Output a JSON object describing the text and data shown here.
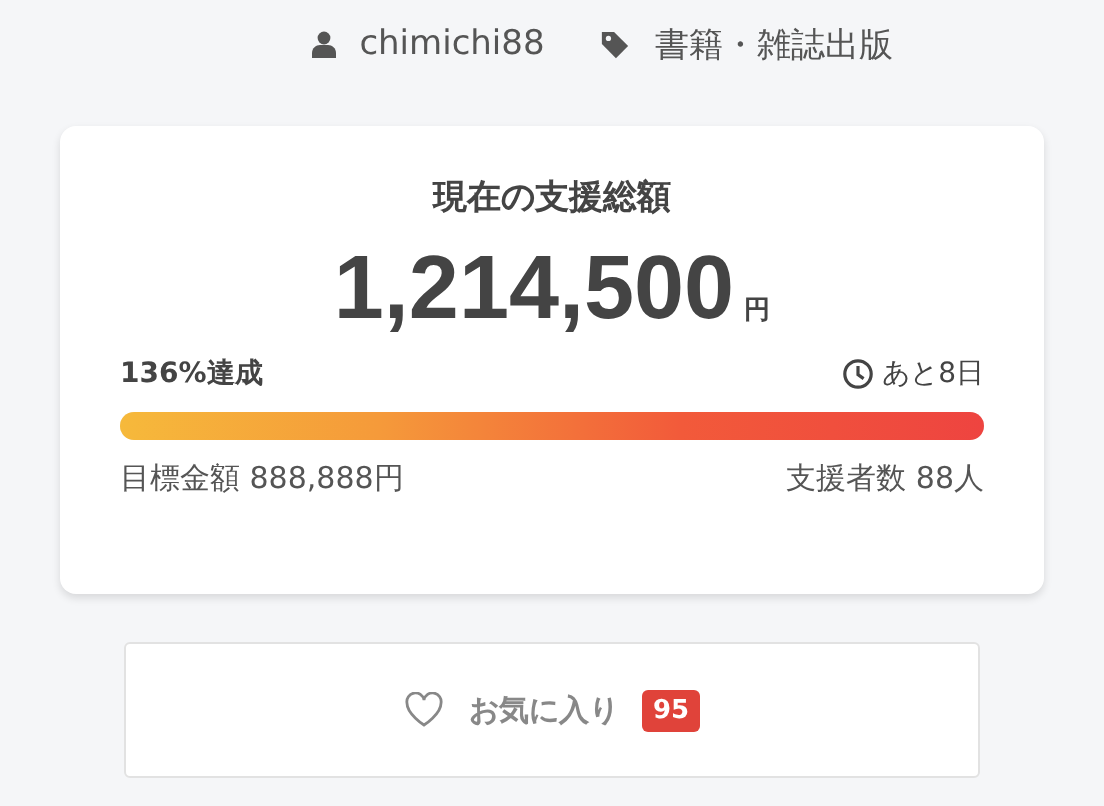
{
  "meta": {
    "author": "chimichi88",
    "category": "書籍・雑誌出版"
  },
  "funding": {
    "title": "現在の支援総額",
    "amount": "1,214,500",
    "currency": "円",
    "achievement": "136%達成",
    "remaining": "あと8日",
    "level": 1,
    "goal": "目標金額 888,888円",
    "backers": "支援者数 88人"
  },
  "favorite": {
    "label": "お気に入り",
    "count": "95"
  }
}
